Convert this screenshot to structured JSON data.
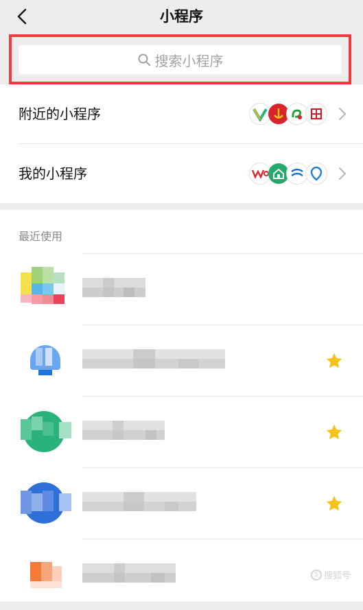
{
  "nav": {
    "title": "小程序"
  },
  "search": {
    "placeholder": "搜索小程序"
  },
  "menu": {
    "items": [
      {
        "label": "附近的小程序"
      },
      {
        "label": "我的小程序"
      }
    ]
  },
  "recent": {
    "title": "最近使用",
    "items": [
      {
        "starred": false
      },
      {
        "starred": true
      },
      {
        "starred": true
      },
      {
        "starred": true
      },
      {
        "starred": false
      }
    ]
  },
  "watermark": {
    "text": "搜狐号"
  },
  "colors": {
    "accent_red": "#f03a3e",
    "star": "#f5c319",
    "background": "#ededed"
  }
}
